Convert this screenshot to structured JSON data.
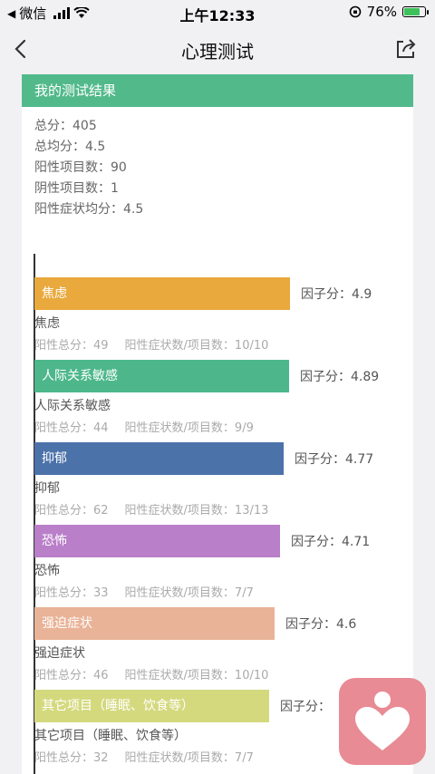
{
  "status_bar": {
    "back_app": "微信",
    "time": "上午12:33",
    "battery": "76%"
  },
  "nav": {
    "title": "心理测试",
    "back_icon": "chevron-left-icon",
    "share_icon": "share-icon"
  },
  "result": {
    "header": "我的测试结果",
    "summary": [
      "总分：405",
      "总均分：4.5",
      "阳性项目数：90",
      "阴性项目数：1",
      "阳性症状均分：4.5"
    ]
  },
  "chart_data": {
    "type": "bar",
    "orientation": "horizontal",
    "title": "",
    "xlabel": "",
    "ylabel": "",
    "categories": [
      "焦虑",
      "人际关系敏感",
      "抑郁",
      "恐怖",
      "强迫症状",
      "其它项目（睡眠、饮食等）"
    ],
    "values": [
      4.9,
      4.89,
      4.77,
      4.71,
      4.6,
      4.5
    ],
    "colors": [
      "#e9a93d",
      "#4db78b",
      "#4c72aa",
      "#b97fc9",
      "#e9b397",
      "#d4d97e"
    ]
  },
  "factors": [
    {
      "label": "焦虑",
      "score_text": "因子分：4.9",
      "name": "焦虑",
      "total": "阳性总分：49",
      "count": "阳性症状数/项目数：10/10"
    },
    {
      "label": "人际关系敏感",
      "score_text": "因子分：4.89",
      "name": "人际关系敏感",
      "total": "阳性总分：44",
      "count": "阳性症状数/项目数：9/9"
    },
    {
      "label": "抑郁",
      "score_text": "因子分：4.77",
      "name": "抑郁",
      "total": "阳性总分：62",
      "count": "阳性症状数/项目数：13/13"
    },
    {
      "label": "恐怖",
      "score_text": "因子分：4.71",
      "name": "恐怖",
      "total": "阳性总分：33",
      "count": "阳性症状数/项目数：7/7"
    },
    {
      "label": "强迫症状",
      "score_text": "因子分：4.6",
      "name": "强迫症状",
      "total": "阳性总分：46",
      "count": "阳性症状数/项目数：10/10"
    },
    {
      "label": "其它项目（睡眠、饮食等）",
      "score_text": "因子分：",
      "name": "其它项目（睡眠、饮食等）",
      "total": "阳性总分：32",
      "count": "阳性症状数/项目数：7/7"
    }
  ],
  "float_icon": "heart-person-icon"
}
